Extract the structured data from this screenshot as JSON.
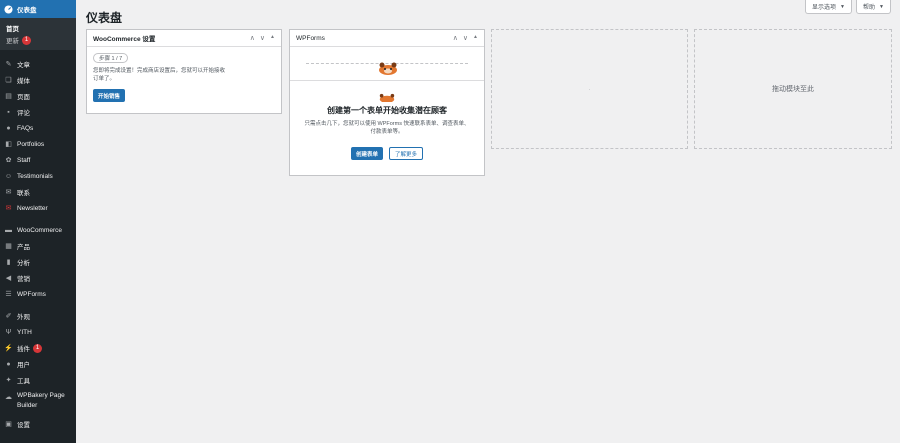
{
  "sidebar": {
    "dashboard_label": "仪表盘",
    "submenu": [
      {
        "label": "首页"
      },
      {
        "label": "更新",
        "badge": "1"
      }
    ],
    "group1": [
      {
        "label": "文章",
        "icon": "pin-icon"
      },
      {
        "label": "媒体",
        "icon": "media-icon"
      },
      {
        "label": "页面",
        "icon": "page-icon"
      },
      {
        "label": "评论",
        "icon": "comment-icon"
      },
      {
        "label": "FAQs",
        "icon": "question-icon"
      },
      {
        "label": "Portfolios",
        "icon": "portfolio-icon"
      },
      {
        "label": "Staff",
        "icon": "staff-icon"
      },
      {
        "label": "Testimonials",
        "icon": "testimonial-icon"
      },
      {
        "label": "联系",
        "icon": "mail-icon"
      },
      {
        "label": "Newsletter",
        "icon": "newsletter-icon"
      }
    ],
    "group2": [
      {
        "label": "WooCommerce",
        "icon": "woocommerce-icon"
      },
      {
        "label": "产品",
        "icon": "product-icon"
      },
      {
        "label": "分析",
        "icon": "analytics-icon"
      },
      {
        "label": "营销",
        "icon": "megaphone-icon"
      },
      {
        "label": "WPForms",
        "icon": "wpforms-icon"
      }
    ],
    "group3": [
      {
        "label": "外观",
        "icon": "brush-icon"
      },
      {
        "label": "YITH",
        "icon": "yith-icon"
      },
      {
        "label": "插件",
        "icon": "plugin-icon",
        "badge": "1"
      },
      {
        "label": "用户",
        "icon": "user-icon"
      },
      {
        "label": "工具",
        "icon": "wrench-icon"
      },
      {
        "label": "WPBakery Page Builder",
        "icon": "wpbakery-icon"
      },
      {
        "label": "设置",
        "icon": "settings-icon"
      }
    ]
  },
  "header": {
    "title": "仪表盘",
    "screen_options": "显示选项",
    "help": "帮助"
  },
  "woocommerce_box": {
    "title": "WooCommerce 设置",
    "step": "步骤 1 / 7",
    "text": "您即将完成设置！完成商店设置后，您就可以开始接收订单了。",
    "button": "开始销售"
  },
  "wpforms_box": {
    "title": "WPForms",
    "headline": "创建第一个表单开始收集潜在顾客",
    "desc": "只需点击几下，您就可以使用 WPForms 快速联系表单、调查表单、付款表单等。",
    "primary_button": "创建表单",
    "secondary_button": "了解更多"
  },
  "drop_zone": {
    "label": "拖动模块至此"
  },
  "colors": {
    "sidebar_bg": "#1d2327",
    "accent": "#2271b1",
    "badge": "#d63638"
  }
}
